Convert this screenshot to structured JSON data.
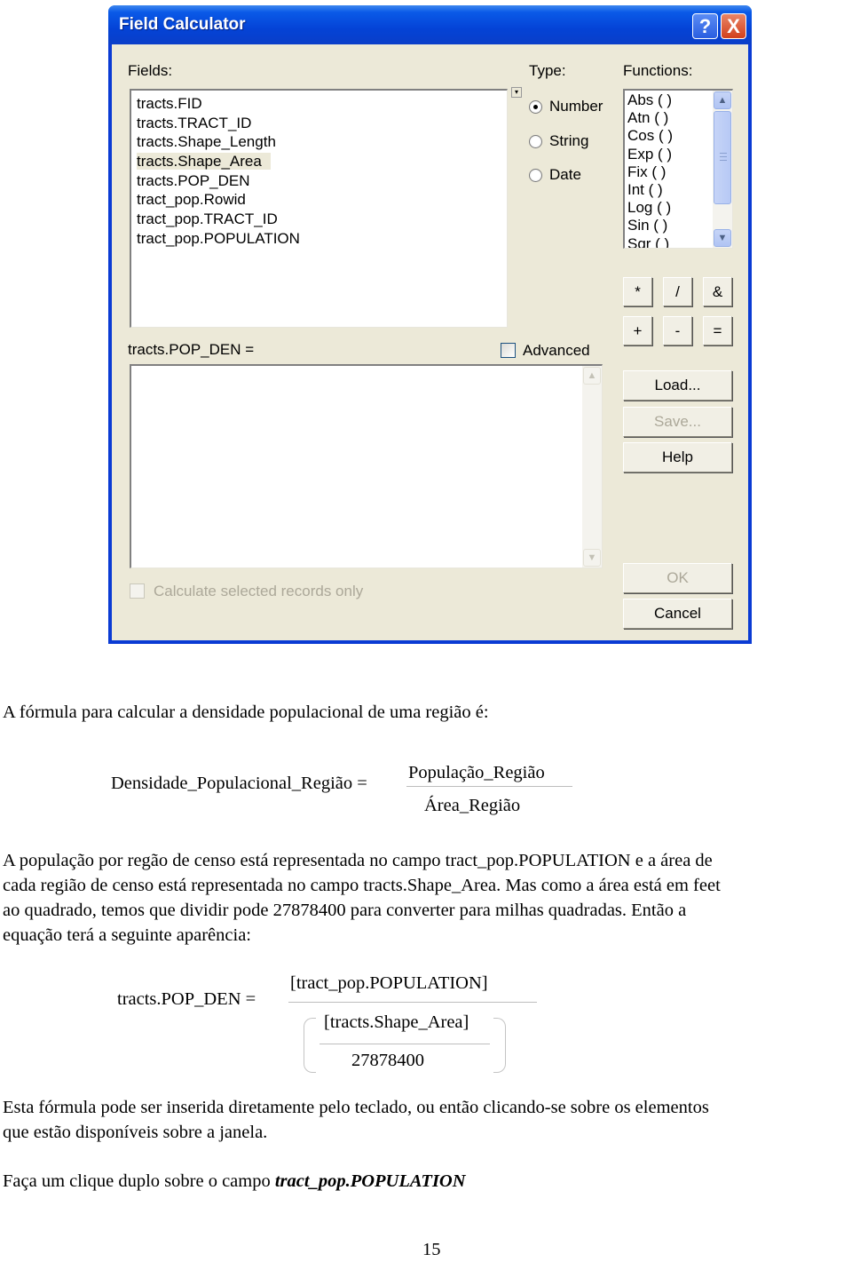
{
  "dialog": {
    "title": "Field Calculator",
    "help_button": "?",
    "close_button": "X",
    "fields_label": "Fields:",
    "fields": [
      "tracts.FID",
      "tracts.TRACT_ID",
      "tracts.Shape_Length",
      "tracts.Shape_Area",
      "tracts.POP_DEN",
      "tract_pop.Rowid",
      "tract_pop.TRACT_ID",
      "tract_pop.POPULATION"
    ],
    "selected_field": "tracts.Shape_Area",
    "type_label": "Type:",
    "types": [
      {
        "label": "Number",
        "checked": true
      },
      {
        "label": "String",
        "checked": false
      },
      {
        "label": "Date",
        "checked": false
      }
    ],
    "functions_label": "Functions:",
    "functions": [
      "Abs ( )",
      "Atn ( )",
      "Cos ( )",
      "Exp ( )",
      "Fix ( )",
      "Int ( )",
      "Log ( )",
      "Sin ( )",
      "Sqr ( )"
    ],
    "operators": [
      "*",
      "/",
      "&",
      "+",
      "-",
      "="
    ],
    "expression_label": "tracts.POP_DEN =",
    "expression_value": "",
    "advanced_label": "Advanced",
    "advanced_checked": false,
    "load_button": "Load...",
    "save_button": "Save...",
    "help_text_button": "Help",
    "calc_selected_label": "Calculate selected records only",
    "ok_button": "OK",
    "cancel_button": "Cancel"
  },
  "document": {
    "intro": "A fórmula para calcular a densidade populacional de uma região é:",
    "formula1": {
      "lhs": "Densidade_Populacional_Região =",
      "numerator": "População_Região",
      "denominator": "Área_Região"
    },
    "paragraph2_lines": [
      "A população por regão de censo está representada no campo tract_pop.POPULATION e a área de",
      "cada região de censo está representada no campo tracts.Shape_Area. Mas como a área está em feet",
      "ao quadrado, temos que dividir pode 27878400 para converter para milhas quadradas. Então a",
      "equação terá a seguinte aparência:"
    ],
    "formula2": {
      "lhs": "tracts.POP_DEN =",
      "numerator": "[tract_pop.POPULATION]",
      "inner_numerator": "[tracts.Shape_Area]",
      "inner_denominator": "27878400"
    },
    "paragraph3_lines": [
      "Esta fórmula pode ser inserida diretamente pelo teclado, ou então clicando-se sobre os elementos",
      "que estão disponíveis sobre a janela."
    ],
    "instruction_prefix": "Faça um clique duplo sobre o campo ",
    "instruction_field": "tract_pop.POPULATION",
    "page_number": "15"
  }
}
